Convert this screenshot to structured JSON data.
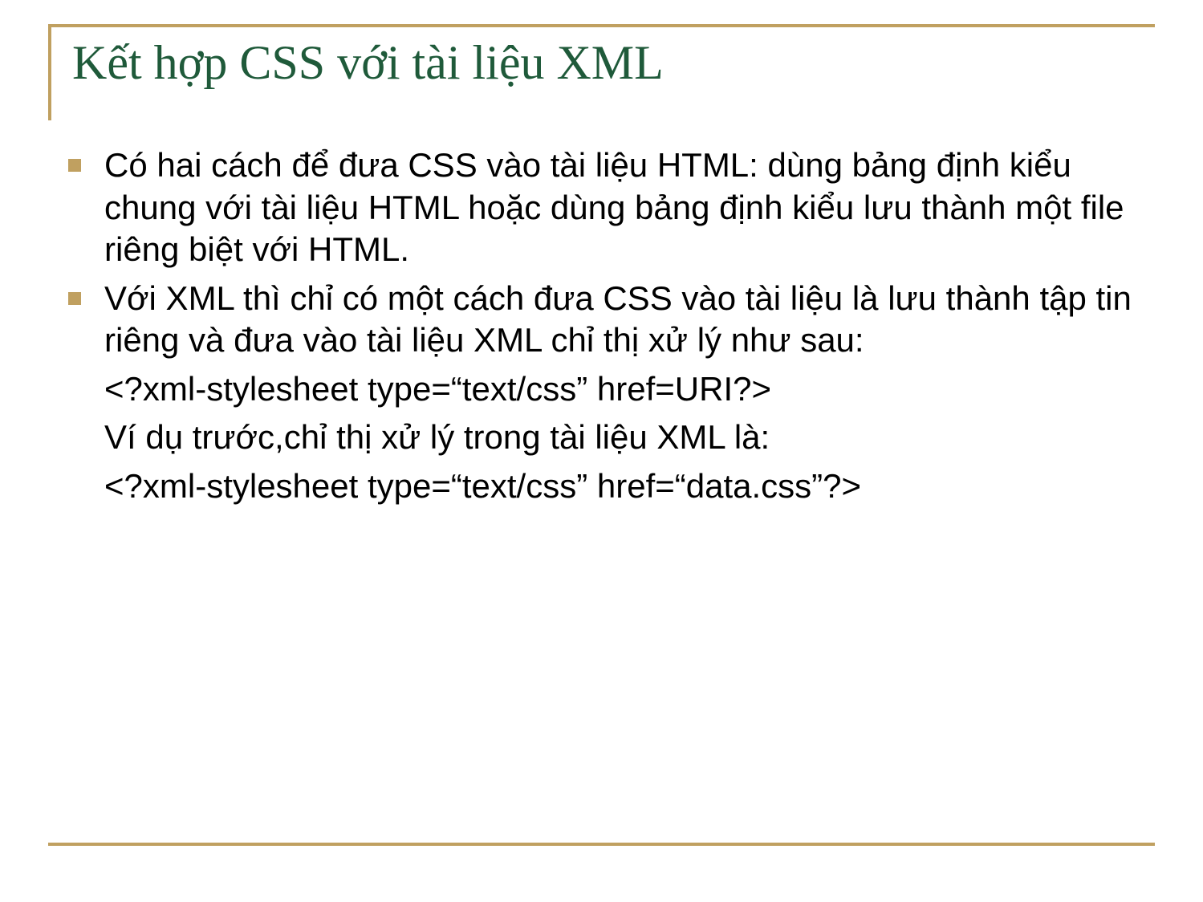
{
  "title": "Kết hợp CSS với tài liệu XML",
  "bullets": [
    "Có hai cách để đưa CSS vào tài liệu HTML: dùng bảng định kiểu chung với tài liệu HTML hoặc dùng bảng định kiểu lưu thành một file riêng biệt với HTML.",
    "Với XML thì chỉ có một cách đưa CSS vào tài liệu là lưu thành tập tin riêng và đưa vào tài liệu XML chỉ thị xử lý như sau:"
  ],
  "subs": [
    "<?xml-stylesheet type=“text/css” href=URI?>",
    "Ví dụ trước,chỉ thị xử lý trong tài liệu XML là:",
    "<?xml-stylesheet type=“text/css” href=“data.css”?>"
  ],
  "colors": {
    "accent": "#c0a060",
    "title": "#1f5a3a"
  }
}
